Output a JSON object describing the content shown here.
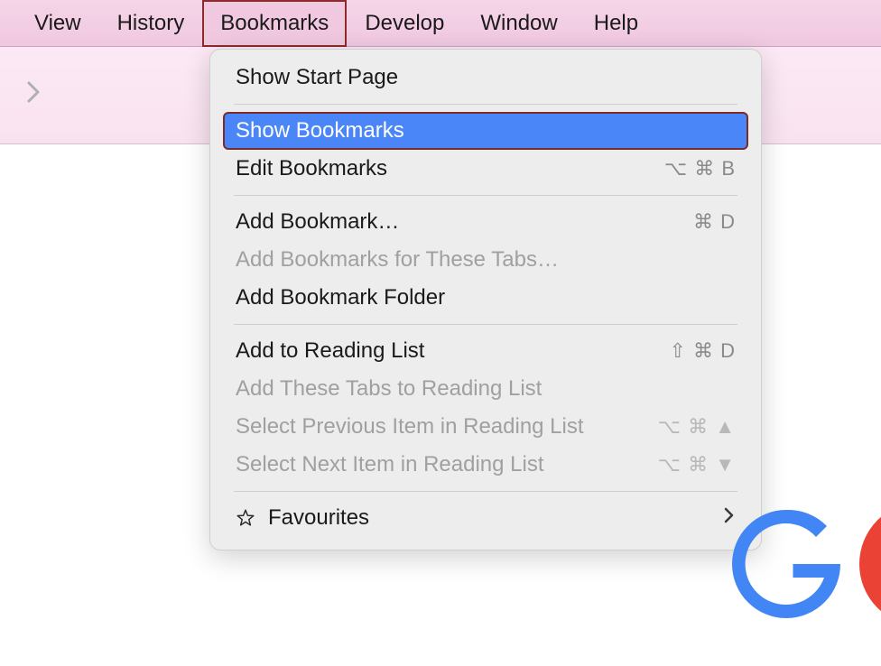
{
  "menubar": {
    "items": [
      {
        "label": "View"
      },
      {
        "label": "History"
      },
      {
        "label": "Bookmarks"
      },
      {
        "label": "Develop"
      },
      {
        "label": "Window"
      },
      {
        "label": "Help"
      }
    ]
  },
  "dropdown": {
    "groups": [
      [
        {
          "label": "Show Start Page",
          "shortcut": "",
          "disabled": false
        }
      ],
      [
        {
          "label": "Show Bookmarks",
          "shortcut": "",
          "disabled": false,
          "highlighted": true
        },
        {
          "label": "Edit Bookmarks",
          "shortcut": "⌥ ⌘ B",
          "disabled": false
        }
      ],
      [
        {
          "label": "Add Bookmark…",
          "shortcut": "⌘ D",
          "disabled": false
        },
        {
          "label": "Add Bookmarks for These Tabs…",
          "shortcut": "",
          "disabled": true
        },
        {
          "label": "Add Bookmark Folder",
          "shortcut": "",
          "disabled": false
        }
      ],
      [
        {
          "label": "Add to Reading List",
          "shortcut": "⇧ ⌘ D",
          "disabled": false
        },
        {
          "label": "Add These Tabs to Reading List",
          "shortcut": "",
          "disabled": true
        },
        {
          "label": "Select Previous Item in Reading List",
          "shortcut": "⌥ ⌘ ▲",
          "disabled": true
        },
        {
          "label": "Select Next Item in Reading List",
          "shortcut": "⌥ ⌘ ▼",
          "disabled": true
        }
      ],
      [
        {
          "label": "Favourites",
          "shortcut": "",
          "disabled": false,
          "icon": "star",
          "submenu": true
        }
      ]
    ]
  }
}
